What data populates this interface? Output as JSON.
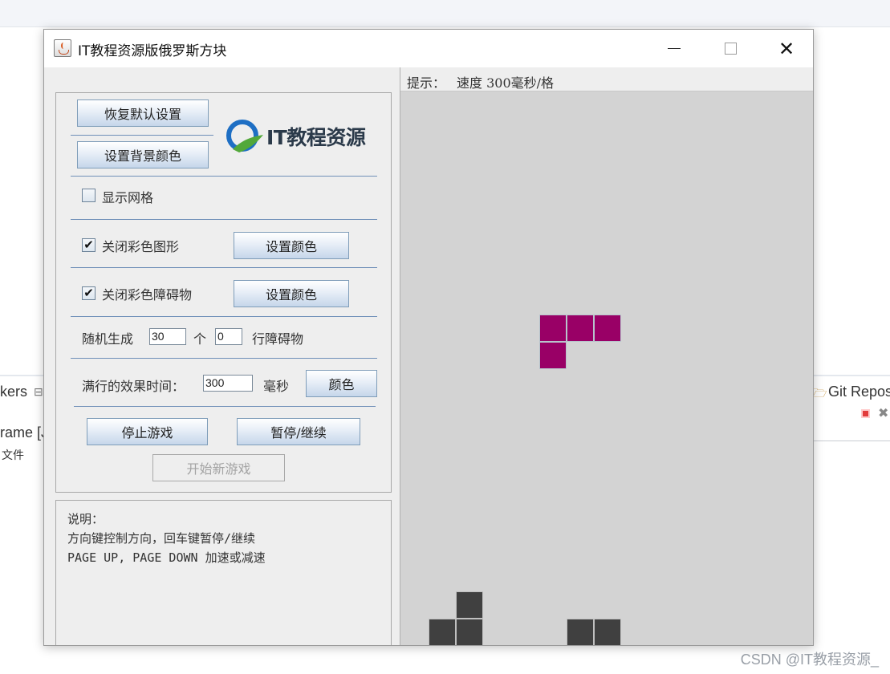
{
  "background": {
    "tab_left": "kers",
    "tab_right": "Git Repos",
    "frame_text": "rame [J",
    "file_text": "文件",
    "watermark": "CSDN @IT教程资源_"
  },
  "window": {
    "title": "IT教程资源版俄罗斯方块"
  },
  "settings": {
    "restore_defaults": "恢复默认设置",
    "set_bg_color": "设置背景颜色",
    "logo_text": "IT教程资源",
    "show_grid": {
      "label": "显示网格",
      "checked": false,
      "mark": ""
    },
    "close_color_shapes": {
      "label": "关闭彩色图形",
      "checked": true,
      "mark": "✔"
    },
    "set_color_1": "设置颜色",
    "close_color_obstacles": {
      "label": "关闭彩色障碍物",
      "checked": true,
      "mark": "✔"
    },
    "set_color_2": "设置颜色",
    "random_prefix": "随机生成",
    "random_count": "30",
    "random_unit": "个",
    "random_rows": "0",
    "random_suffix": "行障碍物",
    "effect_label": "满行的效果时间：",
    "effect_time": "300",
    "effect_unit": "毫秒",
    "effect_color_button": "颜色",
    "stop_game": "停止游戏",
    "pause_resume": "暂停/继续",
    "new_game": "开始新游戏"
  },
  "info": {
    "title": "说明：",
    "line1": "方向键控制方向，回车键暂停/继续",
    "line2": "PAGE UP, PAGE DOWN 加速或减速"
  },
  "game": {
    "hint_label": "提示：",
    "hint_text": "速度 300毫秒/格",
    "colors": {
      "active_piece": "#990066",
      "obstacle": "#404040",
      "board": "#d3d3d3"
    }
  }
}
